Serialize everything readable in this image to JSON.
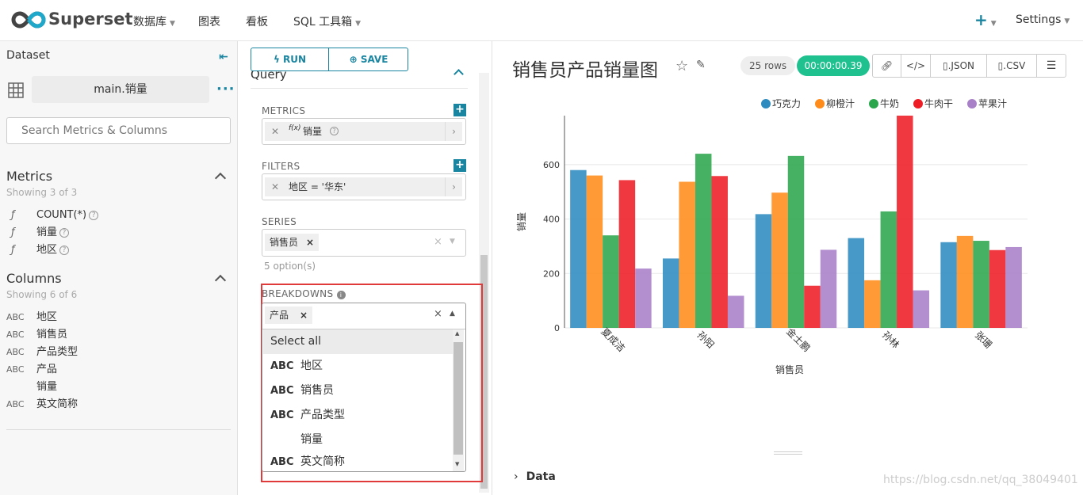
{
  "nav": {
    "brand": "Superset",
    "items": [
      "数据库",
      "图表",
      "看板",
      "SQL 工具箱"
    ],
    "plus": "+",
    "settings": "Settings"
  },
  "left": {
    "dataset_label": "Dataset",
    "dataset_name": "main.销量",
    "search_placeholder": "Search Metrics & Columns",
    "metrics_title": "Metrics",
    "metrics_sub": "Showing 3 of 3",
    "metrics": [
      "COUNT(*)",
      "销量",
      "地区"
    ],
    "columns_title": "Columns",
    "columns_sub": "Showing 6 of 6",
    "columns": [
      {
        "type": "ABC",
        "name": "地区"
      },
      {
        "type": "ABC",
        "name": "销售员"
      },
      {
        "type": "ABC",
        "name": "产品类型"
      },
      {
        "type": "ABC",
        "name": "产品"
      },
      {
        "type": "",
        "name": "销量"
      },
      {
        "type": "ABC",
        "name": "英文简称"
      }
    ]
  },
  "mid": {
    "run_label": "RUN",
    "save_label": "SAVE",
    "query_title": "Query",
    "metrics_label": "METRICS",
    "metric_pill": "销量",
    "metric_fx": "f(x)",
    "filters_label": "FILTERS",
    "filter_pill": "地区 = '华东'",
    "series_label": "SERIES",
    "series_tag": "销售员",
    "series_hint": "5 option(s)",
    "breakdowns_label": "BREAKDOWNS",
    "breakdown_tag": "产品",
    "options": [
      {
        "type": "",
        "name": "Select all"
      },
      {
        "type": "ABC",
        "name": "地区"
      },
      {
        "type": "ABC",
        "name": "销售员"
      },
      {
        "type": "ABC",
        "name": "产品类型"
      },
      {
        "type": "",
        "name": "销量"
      },
      {
        "type": "ABC",
        "name": "英文简称"
      }
    ]
  },
  "right": {
    "chart_title": "销售员产品销量图",
    "rows": "25 rows",
    "timer": "00:00:00.39",
    "json_label": ".JSON",
    "csv_label": ".CSV",
    "data_label": "Data",
    "watermark": "https://blog.csdn.net/qq_38049401"
  },
  "colors": {
    "accent": "#1a85a0",
    "timer": "#1fc18e",
    "highlight": "#e03a3a"
  },
  "chart_data": {
    "type": "bar",
    "categories": [
      "夏成洁",
      "孙阳",
      "金士鹏",
      "孙林",
      "张珊"
    ],
    "series": [
      {
        "name": "巧克力",
        "color": "#2e8bc0",
        "values": [
          580,
          255,
          418,
          330,
          315
        ]
      },
      {
        "name": "柳橙汁",
        "color": "#ff8c1a",
        "values": [
          560,
          537,
          497,
          175,
          338
        ]
      },
      {
        "name": "牛奶",
        "color": "#2ca64c",
        "values": [
          340,
          640,
          632,
          428,
          320
        ]
      },
      {
        "name": "牛肉干",
        "color": "#ee1c25",
        "values": [
          543,
          558,
          155,
          780,
          286
        ]
      },
      {
        "name": "苹果汁",
        "color": "#a880c8",
        "values": [
          218,
          118,
          287,
          138,
          297
        ]
      }
    ],
    "xlabel": "销售员",
    "ylabel": "销量",
    "yticks": [
      0,
      200,
      400,
      600
    ],
    "ylim": [
      0,
      780
    ],
    "legend": "top"
  }
}
